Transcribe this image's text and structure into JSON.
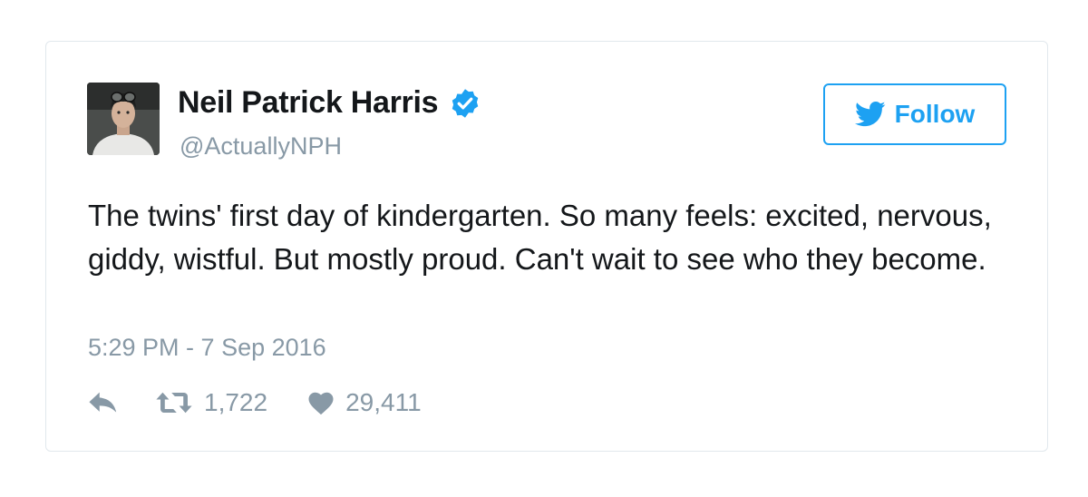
{
  "tweet": {
    "author": {
      "display_name": "Neil Patrick Harris",
      "handle": "@ActuallyNPH",
      "verified": true,
      "avatar_icon": "profile-photo"
    },
    "follow_button": {
      "label": "Follow",
      "icon": "twitter-bird-icon"
    },
    "text": "The twins' first day of kindergarten. So many feels: excited, nervous, giddy, wistful. But mostly proud. Can't wait to see who they become.",
    "timestamp": "5:29 PM - 7 Sep 2016",
    "actions": {
      "reply_icon": "reply-icon",
      "retweet_icon": "retweet-icon",
      "retweet_count": "1,722",
      "like_icon": "heart-icon",
      "like_count": "29,411"
    }
  },
  "colors": {
    "accent": "#1da1f2",
    "text": "#14171a",
    "muted": "#8899a6",
    "border": "#e1e8ed"
  }
}
